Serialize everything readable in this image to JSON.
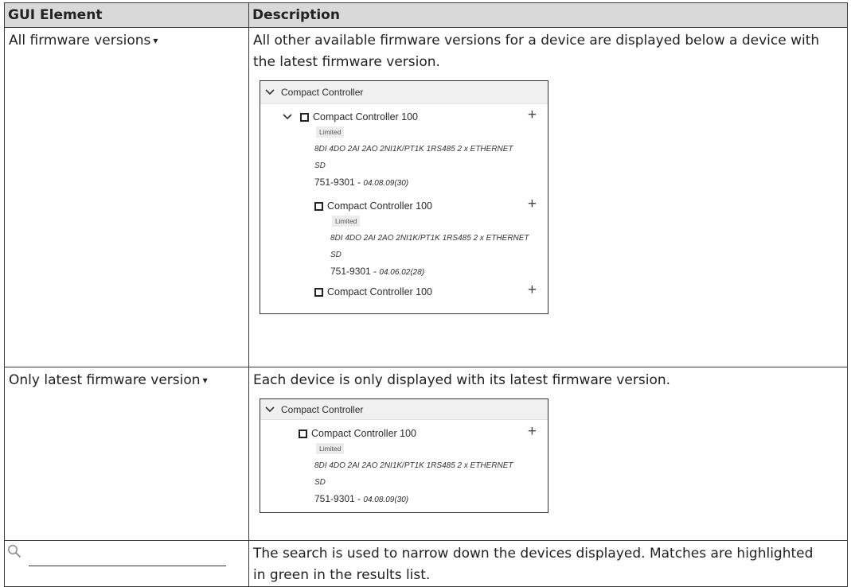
{
  "table": {
    "header": {
      "col1": "GUI Element",
      "col2": "Description"
    },
    "rows": [
      {
        "element": "All firmware versions",
        "element_icon": "dropdown-arrow-icon",
        "description": "All other available firmware versions for a device are displayed below a device with the latest firmware version.",
        "shot": {
          "group": "Compact Controller",
          "devices": [
            {
              "name": "Compact Controller 100",
              "badge": "Limited",
              "specs": "8DI 4DO 2AI 2AO 2NI1K/PT1K 1RS485 2 x ETHERNET SD",
              "order": "751-9301",
              "version": "04.08.09(30)"
            },
            {
              "name": "Compact Controller 100",
              "badge": "Limited",
              "specs": "8DI 4DO 2AI 2AO 2NI1K/PT1K 1RS485 2 x ETHERNET SD",
              "order": "751-9301",
              "version": "04.06.02(28)"
            },
            {
              "name": "Compact Controller 100"
            }
          ]
        }
      },
      {
        "element": "Only latest firmware version",
        "element_icon": "dropdown-arrow-icon",
        "description": "Each device is only displayed with its latest firmware version.",
        "shot": {
          "group": "Compact Controller",
          "devices": [
            {
              "name": "Compact Controller 100",
              "badge": "Limited",
              "specs": "8DI 4DO 2AI 2AO 2NI1K/PT1K 1RS485 2 x ETHERNET SD",
              "order": "751-9301",
              "version": "04.08.09(30)"
            }
          ]
        }
      },
      {
        "element_icon": "search-icon",
        "description": "The search is used to narrow down the devices displayed. Matches are highlighted in green in the results list."
      }
    ]
  },
  "glyphs": {
    "dropdown": "▾",
    "chevron": "⌵",
    "plus": "+",
    "separator": " - "
  }
}
